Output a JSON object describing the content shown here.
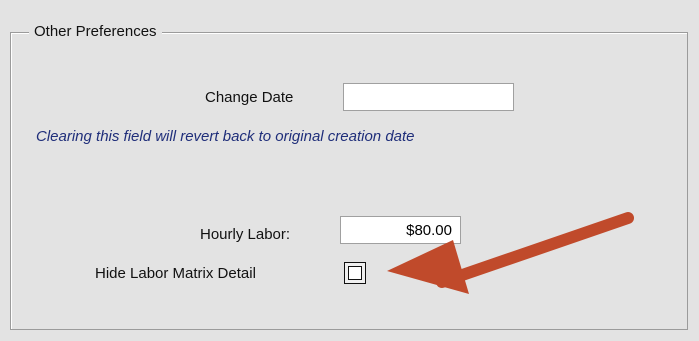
{
  "group": {
    "title": "Other Preferences"
  },
  "change_date": {
    "label": "Change Date",
    "value": "",
    "note": "Clearing this field will revert back to original creation date"
  },
  "hourly_labor": {
    "label": "Hourly Labor:",
    "value": "$80.00"
  },
  "hide_labor_matrix": {
    "label": "Hide Labor Matrix Detail",
    "checked": false
  },
  "annotation": {
    "icon": "arrow-pointer-icon",
    "color": "#c04a2b"
  }
}
